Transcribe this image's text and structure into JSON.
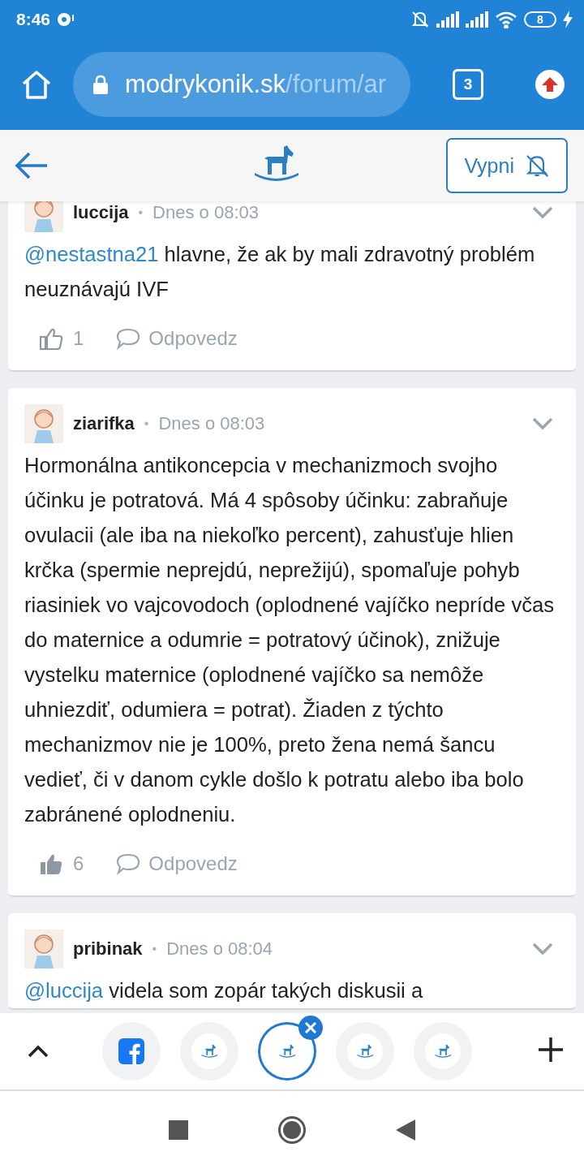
{
  "status_bar": {
    "time": "8:46",
    "battery": "8"
  },
  "address_bar": {
    "domain": "modrykonik.sk",
    "path": "/forum/ar",
    "tab_count": "3"
  },
  "site_header": {
    "button": "Vypni"
  },
  "posts": [
    {
      "author": "luccija",
      "separator": "•",
      "time": "Dnes o 08:03",
      "mention": "@nestastna21",
      "text": "hlavne, že ak by mali zdravotný problém neuznávajú IVF",
      "likes": "1",
      "liked": false,
      "reply": "Odpovedz"
    },
    {
      "author": "ziarifka",
      "separator": "•",
      "time": "Dnes o 08:03",
      "text": "Hormonálna antikoncepcia v mechanizmoch svojho účinku je potratová. Má 4 spôsoby účinku: zabraňuje ovulacii (ale iba na niekoľko percent), zahusťuje hlien krčka (spermie neprejdú, neprežijú), spomaľuje pohyb riasiniek vo vajcovodoch (oplodnené vajíčko nepríde včas do maternice a odumrie = potratový účinok), znižuje vystelku maternice (oplodnené vajíčko sa nemôže uhniezdiť, odumiera = potrat). Žiaden z týchto mechanizmov nie je 100%, preto žena nemá šancu vedieť, či v danom cykle došlo k potratu alebo iba bolo zabránené oplodneniu.",
      "likes": "6",
      "liked": true,
      "reply": "Odpovedz"
    },
    {
      "author": "pribinak",
      "separator": "•",
      "time": "Dnes o 08:04",
      "mention": "@luccija",
      "text": "videla som zopár takých diskusii a"
    }
  ],
  "tabs": [
    {
      "kind": "facebook",
      "selected": false
    },
    {
      "kind": "site",
      "selected": false
    },
    {
      "kind": "site",
      "selected": true
    },
    {
      "kind": "site",
      "selected": false
    },
    {
      "kind": "site",
      "selected": false
    }
  ]
}
